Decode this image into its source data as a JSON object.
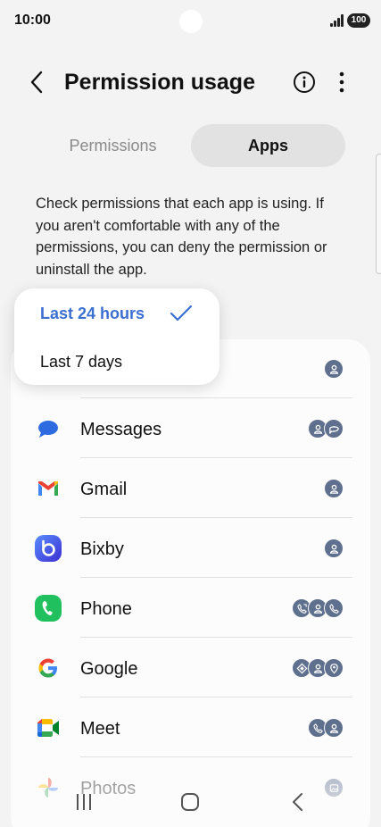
{
  "status_bar": {
    "time": "10:00",
    "battery": "100"
  },
  "header": {
    "title": "Permission usage"
  },
  "tabs": [
    {
      "label": "Permissions",
      "selected": false
    },
    {
      "label": "Apps",
      "selected": true
    }
  ],
  "description": "Check permissions that each app is using. If you aren't comfortable with any of the permissions, you can deny the permission or uninstall the app.",
  "time_filter": {
    "options": [
      "Last 24 hours",
      "Last 7 days"
    ],
    "selected": "Last 24 hours"
  },
  "apps": [
    {
      "name": "",
      "permissions": [
        "contacts-icon"
      ]
    },
    {
      "name": "Messages",
      "permissions": [
        "contacts-icon",
        "sms-icon"
      ]
    },
    {
      "name": "Gmail",
      "permissions": [
        "contacts-icon"
      ]
    },
    {
      "name": "Bixby",
      "permissions": [
        "contacts-icon"
      ]
    },
    {
      "name": "Phone",
      "permissions": [
        "call-log-icon",
        "contacts-icon",
        "phone-icon"
      ]
    },
    {
      "name": "Google",
      "permissions": [
        "nearby-devices-icon",
        "contacts-icon",
        "location-icon"
      ]
    },
    {
      "name": "Meet",
      "permissions": [
        "phone-icon",
        "contacts-icon"
      ]
    },
    {
      "name": "Photos",
      "permissions": [
        "photos-videos-icon"
      ]
    }
  ],
  "colors": {
    "accent": "#3b6fd0",
    "permission_badge": "#5f6f8e",
    "background": "#f3f3f3"
  }
}
